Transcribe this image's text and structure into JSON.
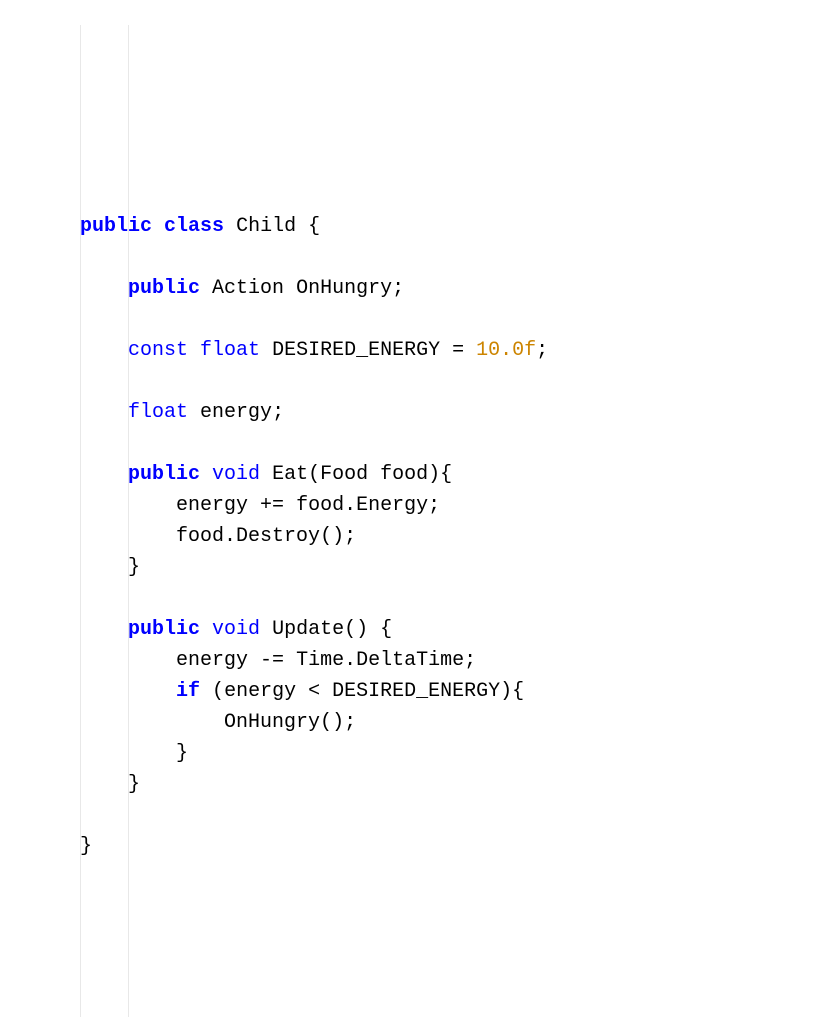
{
  "tokens": {
    "public": "public",
    "class": "class",
    "const": "const",
    "float": "float",
    "void": "void",
    "if": "if",
    "Child": "Child",
    "Action": "Action",
    "OnHungry": "OnHungry",
    "DESIRED_ENERGY": "DESIRED_ENERGY",
    "energy": "energy",
    "Eat": "Eat",
    "Food": "Food",
    "food": "food",
    "Energy": "Energy",
    "Destroy": "Destroy",
    "Update": "Update",
    "Time": "Time",
    "DeltaTime": "DeltaTime",
    "num_10f": "10.0f",
    "lbrace": "{",
    "rbrace": "}",
    "semi": ";",
    "eq": "=",
    "pluseq": "+=",
    "minuseq": "-=",
    "lt": "<",
    "dot": ".",
    "lparen": "(",
    "rparen": ")"
  }
}
